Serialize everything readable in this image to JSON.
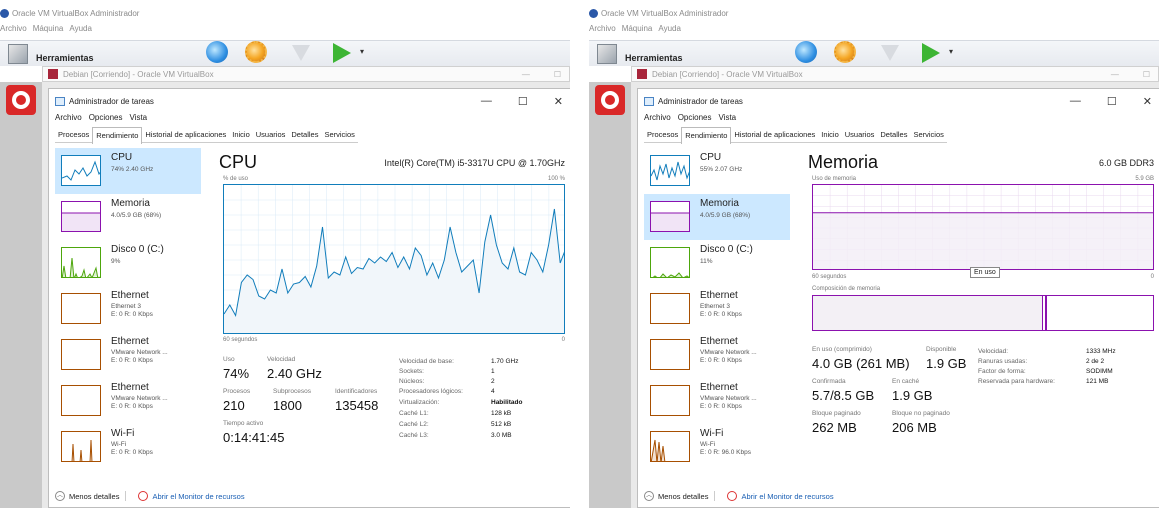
{
  "common": {
    "vb_title": "Oracle VM VirtualBox Administrador",
    "vb_menu": [
      "Archivo",
      "Máquina",
      "Ayuda"
    ],
    "tools_label": "Herramientas",
    "debian_title": "Debian [Corriendo] - Oracle VM VirtualBox",
    "tm_title": "Administrador de tareas",
    "tm_menu": [
      "Archivo",
      "Opciones",
      "Vista"
    ],
    "tabs": [
      "Procesos",
      "Rendimiento",
      "Historial de aplicaciones",
      "Inicio",
      "Usuarios",
      "Detalles",
      "Servicios"
    ],
    "active_tab": "Rendimiento",
    "footer_less": "Menos detalles",
    "footer_monitor": "Abrir el Monitor de recursos",
    "colors": {
      "cpu": "#117dbb",
      "mem": "#8b12ae",
      "disk": "#4da60c",
      "eth": "#a74f01",
      "select": "#cce8ff"
    }
  },
  "left": {
    "sidebar": [
      {
        "name": "CPU",
        "sub1": "74% 2.40 GHz",
        "sub2": ""
      },
      {
        "name": "Memoria",
        "sub1": "4.0/5.9 GB (68%)",
        "sub2": ""
      },
      {
        "name": "Disco 0 (C:)",
        "sub1": "9%",
        "sub2": ""
      },
      {
        "name": "Ethernet",
        "sub1": "Ethernet 3",
        "sub2": "E: 0 R: 0 Kbps"
      },
      {
        "name": "Ethernet",
        "sub1": "VMware Network ...",
        "sub2": "E: 0 R: 0 Kbps"
      },
      {
        "name": "Ethernet",
        "sub1": "VMware Network ...",
        "sub2": "E: 0 R: 0 Kbps"
      },
      {
        "name": "Wi-Fi",
        "sub1": "Wi-Fi",
        "sub2": "E: 0 R: 0 Kbps"
      }
    ],
    "title": "CPU",
    "spec": "Intel(R) Core(TM) i5-3317U CPU @ 1.70GHz",
    "graph_top_left": "% de uso",
    "graph_top_right": "100 %",
    "graph_bottom_left": "60 segundos",
    "graph_bottom_right": "0",
    "usage_series": [
      14,
      20,
      13,
      35,
      40,
      37,
      26,
      24,
      30,
      28,
      44,
      28,
      34,
      35,
      39,
      32,
      46,
      72,
      38,
      42,
      40,
      52,
      41,
      45,
      44,
      51,
      48,
      52,
      49,
      55,
      45,
      52,
      44,
      58,
      53,
      40,
      48,
      38,
      50,
      72,
      55,
      42,
      46,
      50,
      28,
      62,
      80,
      60,
      48,
      44,
      58,
      42,
      40,
      55,
      50,
      42,
      60,
      84,
      48,
      58
    ],
    "stats": {
      "uso_label": "Uso",
      "uso_value": "74%",
      "vel_label": "Velocidad",
      "vel_value": "2.40 GHz",
      "proc_label": "Procesos",
      "proc_value": "210",
      "sub_label": "Subprocesos",
      "sub_value": "1800",
      "id_label": "Identificadores",
      "id_value": "135458",
      "time_label": "Tiempo activo",
      "time_value": "0:14:41:45"
    },
    "kv": [
      {
        "k": "Velocidad de base:",
        "v": "1.70 GHz"
      },
      {
        "k": "Sockets:",
        "v": "1"
      },
      {
        "k": "Núcleos:",
        "v": "2"
      },
      {
        "k": "Procesadores lógicos:",
        "v": "4"
      },
      {
        "k": "Virtualización:",
        "v": "Habilitado"
      },
      {
        "k": "Caché L1:",
        "v": "128 kB"
      },
      {
        "k": "Caché L2:",
        "v": "512 kB"
      },
      {
        "k": "Caché L3:",
        "v": "3.0 MB"
      }
    ]
  },
  "right": {
    "sidebar": [
      {
        "name": "CPU",
        "sub1": "55% 2.07 GHz",
        "sub2": ""
      },
      {
        "name": "Memoria",
        "sub1": "4.0/5.9 GB (68%)",
        "sub2": ""
      },
      {
        "name": "Disco 0 (C:)",
        "sub1": "11%",
        "sub2": ""
      },
      {
        "name": "Ethernet",
        "sub1": "Ethernet 3",
        "sub2": "E: 0 R: 0 Kbps"
      },
      {
        "name": "Ethernet",
        "sub1": "VMware Network ...",
        "sub2": "E: 0 R: 0 Kbps"
      },
      {
        "name": "Ethernet",
        "sub1": "VMware Network ...",
        "sub2": "E: 0 R: 0 Kbps"
      },
      {
        "name": "Wi-Fi",
        "sub1": "Wi-Fi",
        "sub2": "E: 0 R: 96.0 Kbps"
      }
    ],
    "title": "Memoria",
    "spec": "6.0 GB DDR3",
    "graph_top_left": "Uso de memoria",
    "graph_top_right": "5.9 GB",
    "graph_bottom_left": "60 segundos",
    "graph_bottom_right": "0",
    "tooltip": "En uso",
    "composition_label": "Composición de memoria",
    "stats": {
      "inuse_label": "En uso (comprimido)",
      "inuse_value": "4.0 GB (261 MB)",
      "avail_label": "Disponible",
      "avail_value": "1.9 GB",
      "conf_label": "Confirmada",
      "conf_value": "5.7/8.5 GB",
      "cache_label": "En caché",
      "cache_value": "1.9 GB",
      "paged_label": "Bloque paginado",
      "paged_value": "262 MB",
      "nonpaged_label": "Bloque no paginado",
      "nonpaged_value": "206 MB"
    },
    "kv": [
      {
        "k": "Velocidad:",
        "v": "1333 MHz"
      },
      {
        "k": "Ranuras usadas:",
        "v": "2 de 2"
      },
      {
        "k": "Factor de forma:",
        "v": "SODIMM"
      },
      {
        "k": "Reservada para hardware:",
        "v": "121 MB"
      }
    ]
  }
}
